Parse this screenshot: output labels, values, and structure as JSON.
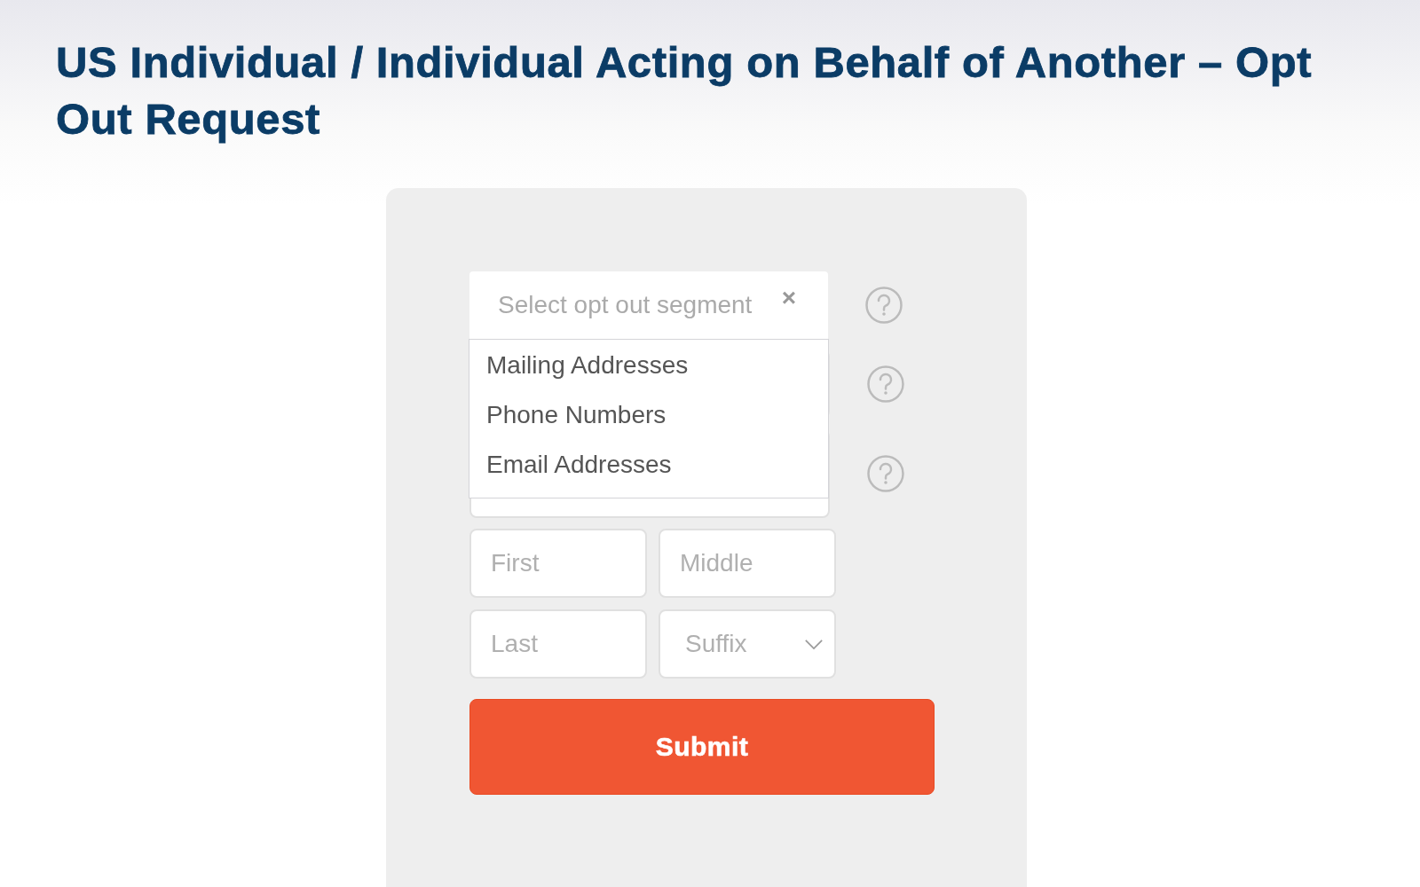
{
  "title": "US Individual / Individual Acting on Behalf of Another – Opt Out Request",
  "segment_select": {
    "placeholder": "Select opt out segment",
    "clear": "×",
    "expanded": true,
    "options": [
      {
        "label": "Mailing Addresses",
        "selected": false
      },
      {
        "label": "Phone Numbers",
        "selected": false
      },
      {
        "label": "Email Addresses",
        "selected": false
      }
    ]
  },
  "name_fields": [
    {
      "kind": "text",
      "placeholder": "First"
    },
    {
      "kind": "text",
      "placeholder": "Middle"
    },
    {
      "kind": "text",
      "placeholder": "Last"
    },
    {
      "kind": "select",
      "placeholder": "Suffix"
    }
  ],
  "submit": "Submit"
}
